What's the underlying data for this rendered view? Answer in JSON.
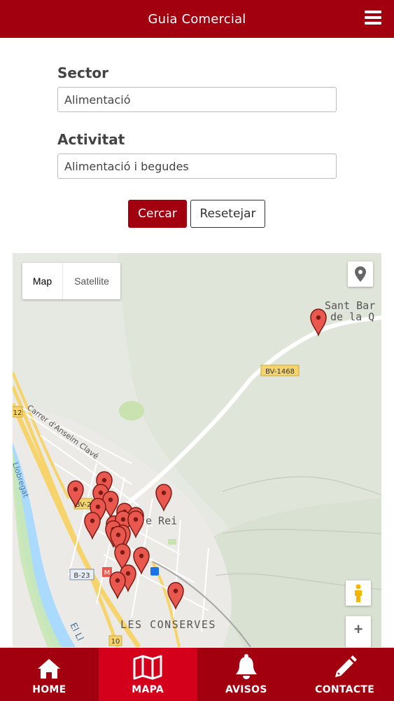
{
  "header": {
    "title": "Guia Comercial",
    "menu_icon": "hamburger-icon"
  },
  "form": {
    "sector_label": "Sector",
    "sector_value": "Alimentació",
    "activitat_label": "Activitat",
    "activitat_value": "Alimentació i begudes",
    "search_button": "Cercar",
    "reset_button": "Resetejar"
  },
  "map": {
    "map_type_map": "Map",
    "map_type_satellite": "Satellite",
    "place_labels": {
      "sant_bartomeu_line1": "Sant Bar",
      "sant_bartomeu_line2": "de la Q",
      "rei": "e Rei",
      "les_conserves": "LES CONSERVES",
      "carrer": "Carrer d'Anselm Clavé",
      "llobregat": "Llobregat",
      "el_llobregat": "El Ll"
    },
    "road_labels": {
      "bv1468": "BV-1468",
      "b23": "B-23",
      "bv2": "BV-2",
      "r12": "12",
      "r10": "10",
      "m": "M"
    },
    "controls": {
      "zoom_in": "+",
      "location_icon": "location-pin-icon",
      "pegman_icon": "pegman-icon"
    },
    "colors": {
      "marker": "#e8584f",
      "marker_stroke": "#7a1a14",
      "road_yellow": "#f6d46b",
      "park": "#cfe3b6"
    }
  },
  "bottom_nav": [
    {
      "label": "HOME",
      "icon": "home-icon",
      "active": false
    },
    {
      "label": "MAPA",
      "icon": "map-icon",
      "active": true
    },
    {
      "label": "AVISOS",
      "icon": "bell-icon",
      "active": false
    },
    {
      "label": "CONTACTE",
      "icon": "pencil-icon",
      "active": false
    }
  ],
  "theme": {
    "primary": "#a3000f",
    "active_tab": "#d4001b"
  }
}
